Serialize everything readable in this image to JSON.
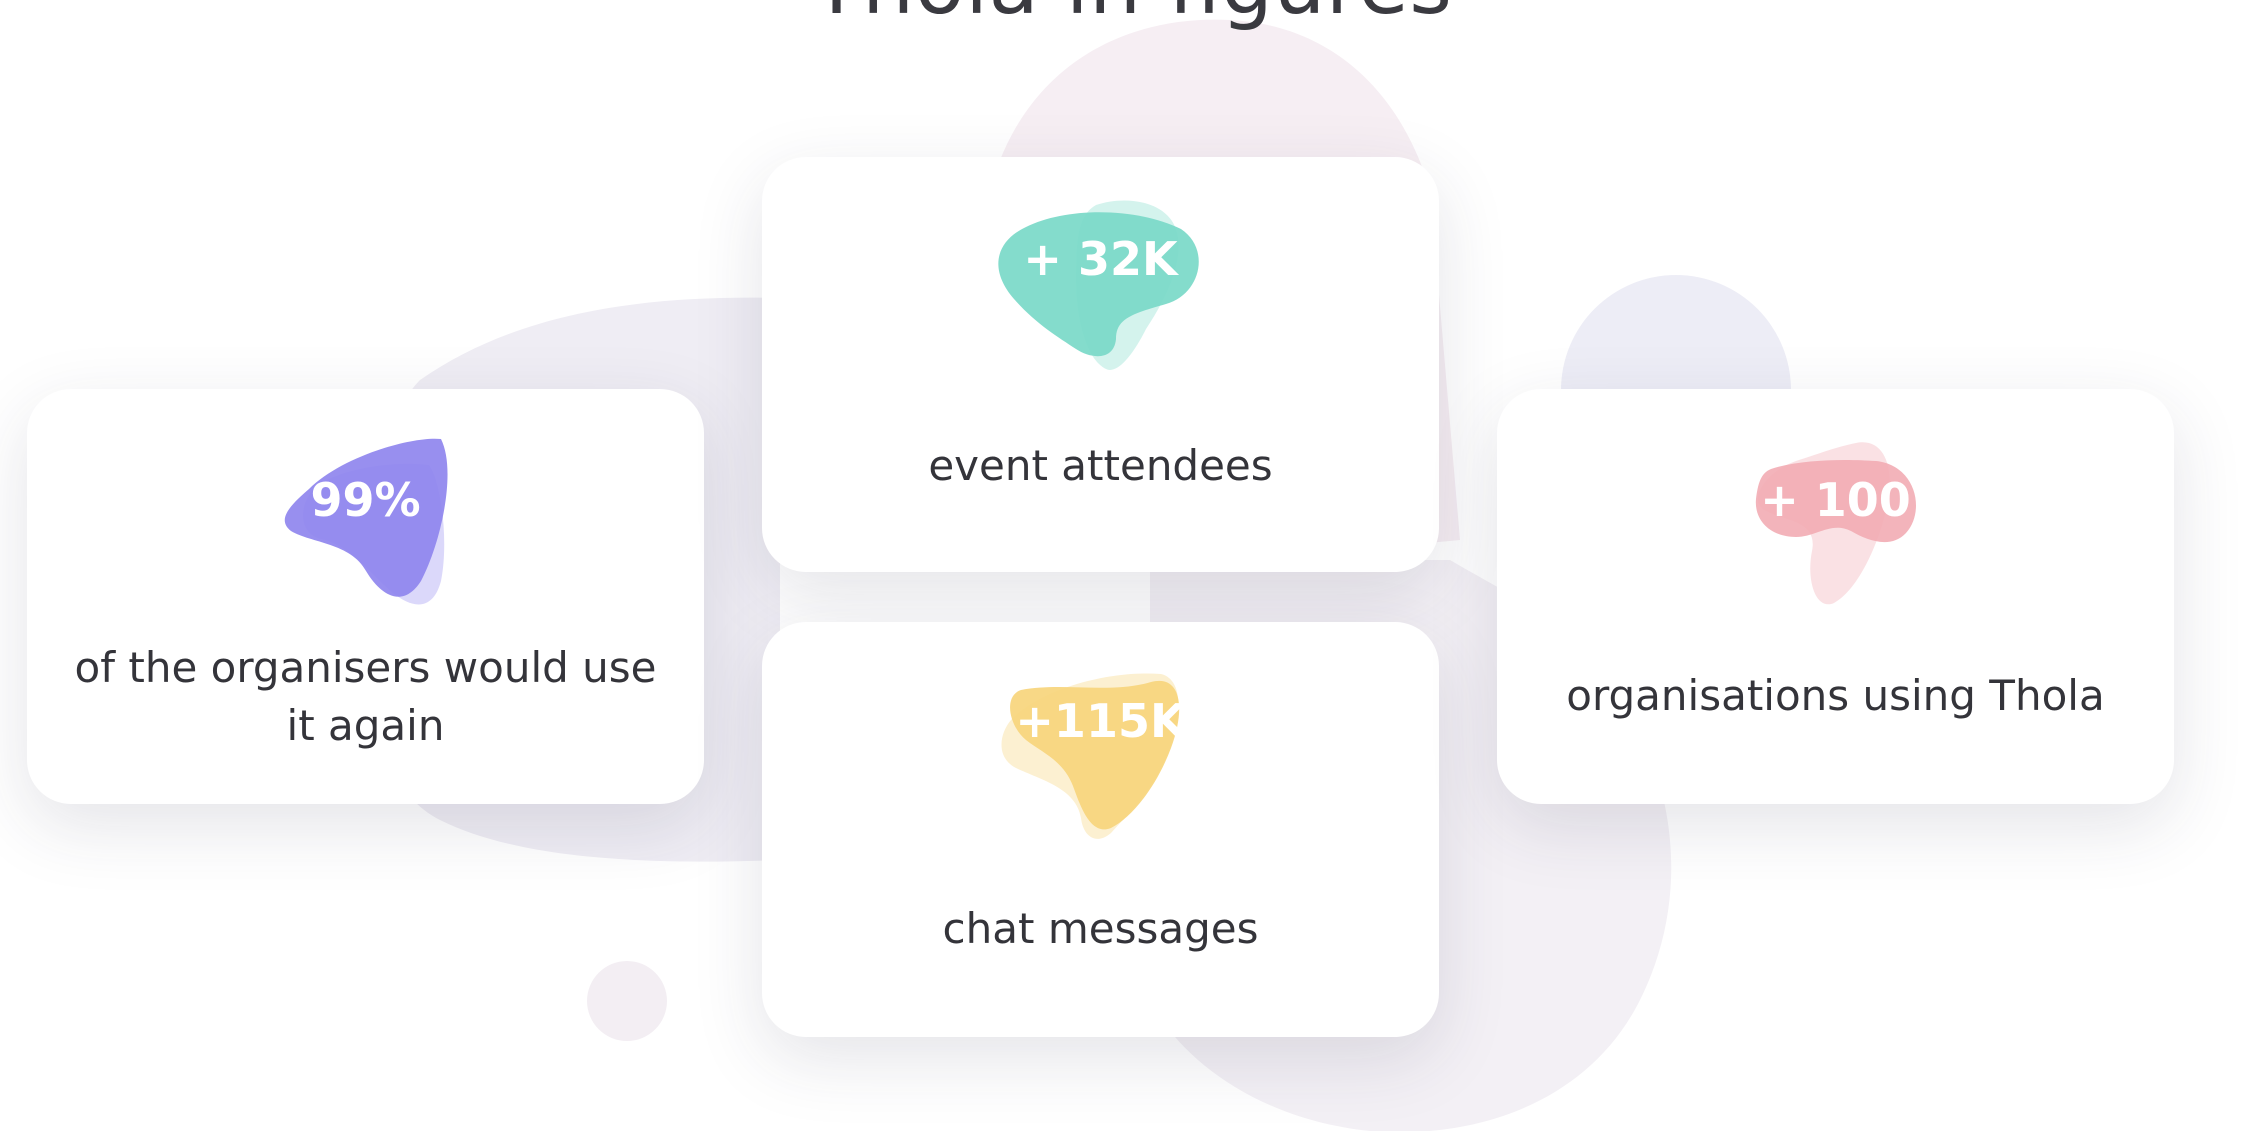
{
  "section": {
    "title": "Thola in figures"
  },
  "stats": {
    "satisfaction": {
      "value": "99%",
      "label": "of the organisers would use it again",
      "color": "#8f85ee"
    },
    "attendees": {
      "value": "+ 32K",
      "label": "event attendees",
      "color": "#79d9c8"
    },
    "messages": {
      "value": "+115K",
      "label": "chat messages",
      "color": "#f7d57c"
    },
    "organisations": {
      "value": "+ 100",
      "label": "organisations using Thola",
      "color": "#f1aab2"
    }
  }
}
